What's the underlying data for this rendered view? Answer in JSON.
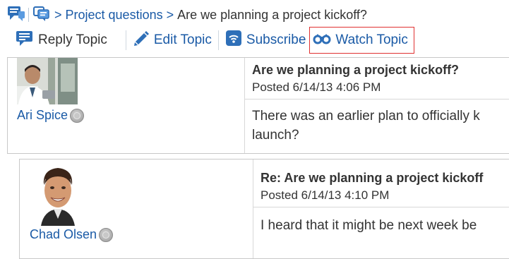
{
  "breadcrumb": {
    "items": [
      {
        "label": "Project questions"
      },
      {
        "label": "Are we planning a project kickoff?"
      }
    ],
    "separator": ">"
  },
  "toolbar": {
    "reply_label": "Reply Topic",
    "edit_label": "Edit Topic",
    "subscribe_label": "Subscribe",
    "watch_label": "Watch Topic"
  },
  "posts": [
    {
      "author": "Ari Spice",
      "title": "Are we planning a project kickoff?",
      "posted": "Posted 6/14/13 4:06 PM",
      "body_line1": "There was an earlier plan to officially k",
      "body_line2": "launch?"
    },
    {
      "author": "Chad Olsen",
      "title": "Re: Are we planning a project kickoff",
      "posted": "Posted 6/14/13 4:10 PM",
      "body_line1": "I heard that it might be next week be"
    }
  ],
  "colors": {
    "link": "#1a5aa6",
    "highlight_border": "#e03131",
    "border": "#c8c8c8",
    "text": "#333333"
  },
  "icons": [
    "forum-icon",
    "topic-icon",
    "reply-icon",
    "edit-pencil-icon",
    "subscribe-icon",
    "watch-binoculars-icon",
    "presence-icon"
  ]
}
